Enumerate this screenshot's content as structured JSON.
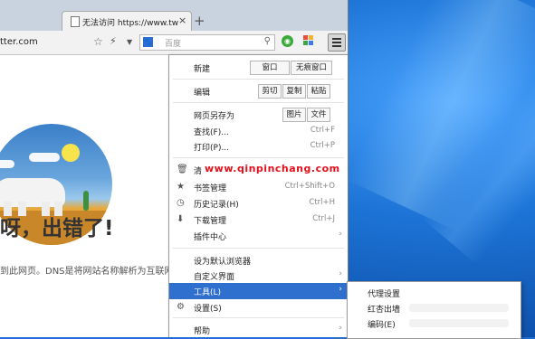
{
  "tab": {
    "title": "无法访问 https://www.tw",
    "close": "×",
    "new_tab": "+"
  },
  "toolbar": {
    "url_text": "tter.com",
    "star": "☆",
    "bolt": "⚡",
    "search_engine_icon": "baidu-paw",
    "search_placeholder": "百度",
    "search_glyph": "⚲"
  },
  "page": {
    "error_title": "呀，出错了!",
    "error_desc": "到此网页。DNS是将网站名称解析为互联网"
  },
  "watermark": "www.qinpinchang.com",
  "menu": {
    "new_label": "新建",
    "new_window": "窗口",
    "new_incognito": "无痕窗口",
    "edit_label": "编辑",
    "cut": "剪切",
    "copy": "复制",
    "paste": "粘贴",
    "save_as_label": "网页另存为",
    "save_image": "图片",
    "save_file": "文件",
    "find": {
      "label": "查找(F)...",
      "shortcut": "Ctrl+F"
    },
    "print": {
      "label": "打印(P)...",
      "shortcut": "Ctrl+P"
    },
    "clear": {
      "label": "清",
      "shortcut": ""
    },
    "bookmarks": {
      "label": "书签管理",
      "shortcut": "Ctrl+Shift+O"
    },
    "history": {
      "label": "历史记录(H)",
      "shortcut": "Ctrl+H"
    },
    "downloads": {
      "label": "下载管理",
      "shortcut": "Ctrl+J"
    },
    "plugins": {
      "label": "插件中心"
    },
    "set_default": {
      "label": "设为默认浏览器"
    },
    "customize": {
      "label": "自定义界面"
    },
    "tools": {
      "label": "工具(L)"
    },
    "settings": {
      "label": "设置(S)"
    },
    "help": {
      "label": "帮助"
    },
    "arrow": "›"
  },
  "submenu": {
    "proxy": "代理设置",
    "item2": "红杏出墙",
    "encoding": "编码(E)"
  },
  "colors": {
    "highlight": "#2f6fce",
    "watermark": "#e3101c",
    "desktop": "#1d74d6"
  }
}
